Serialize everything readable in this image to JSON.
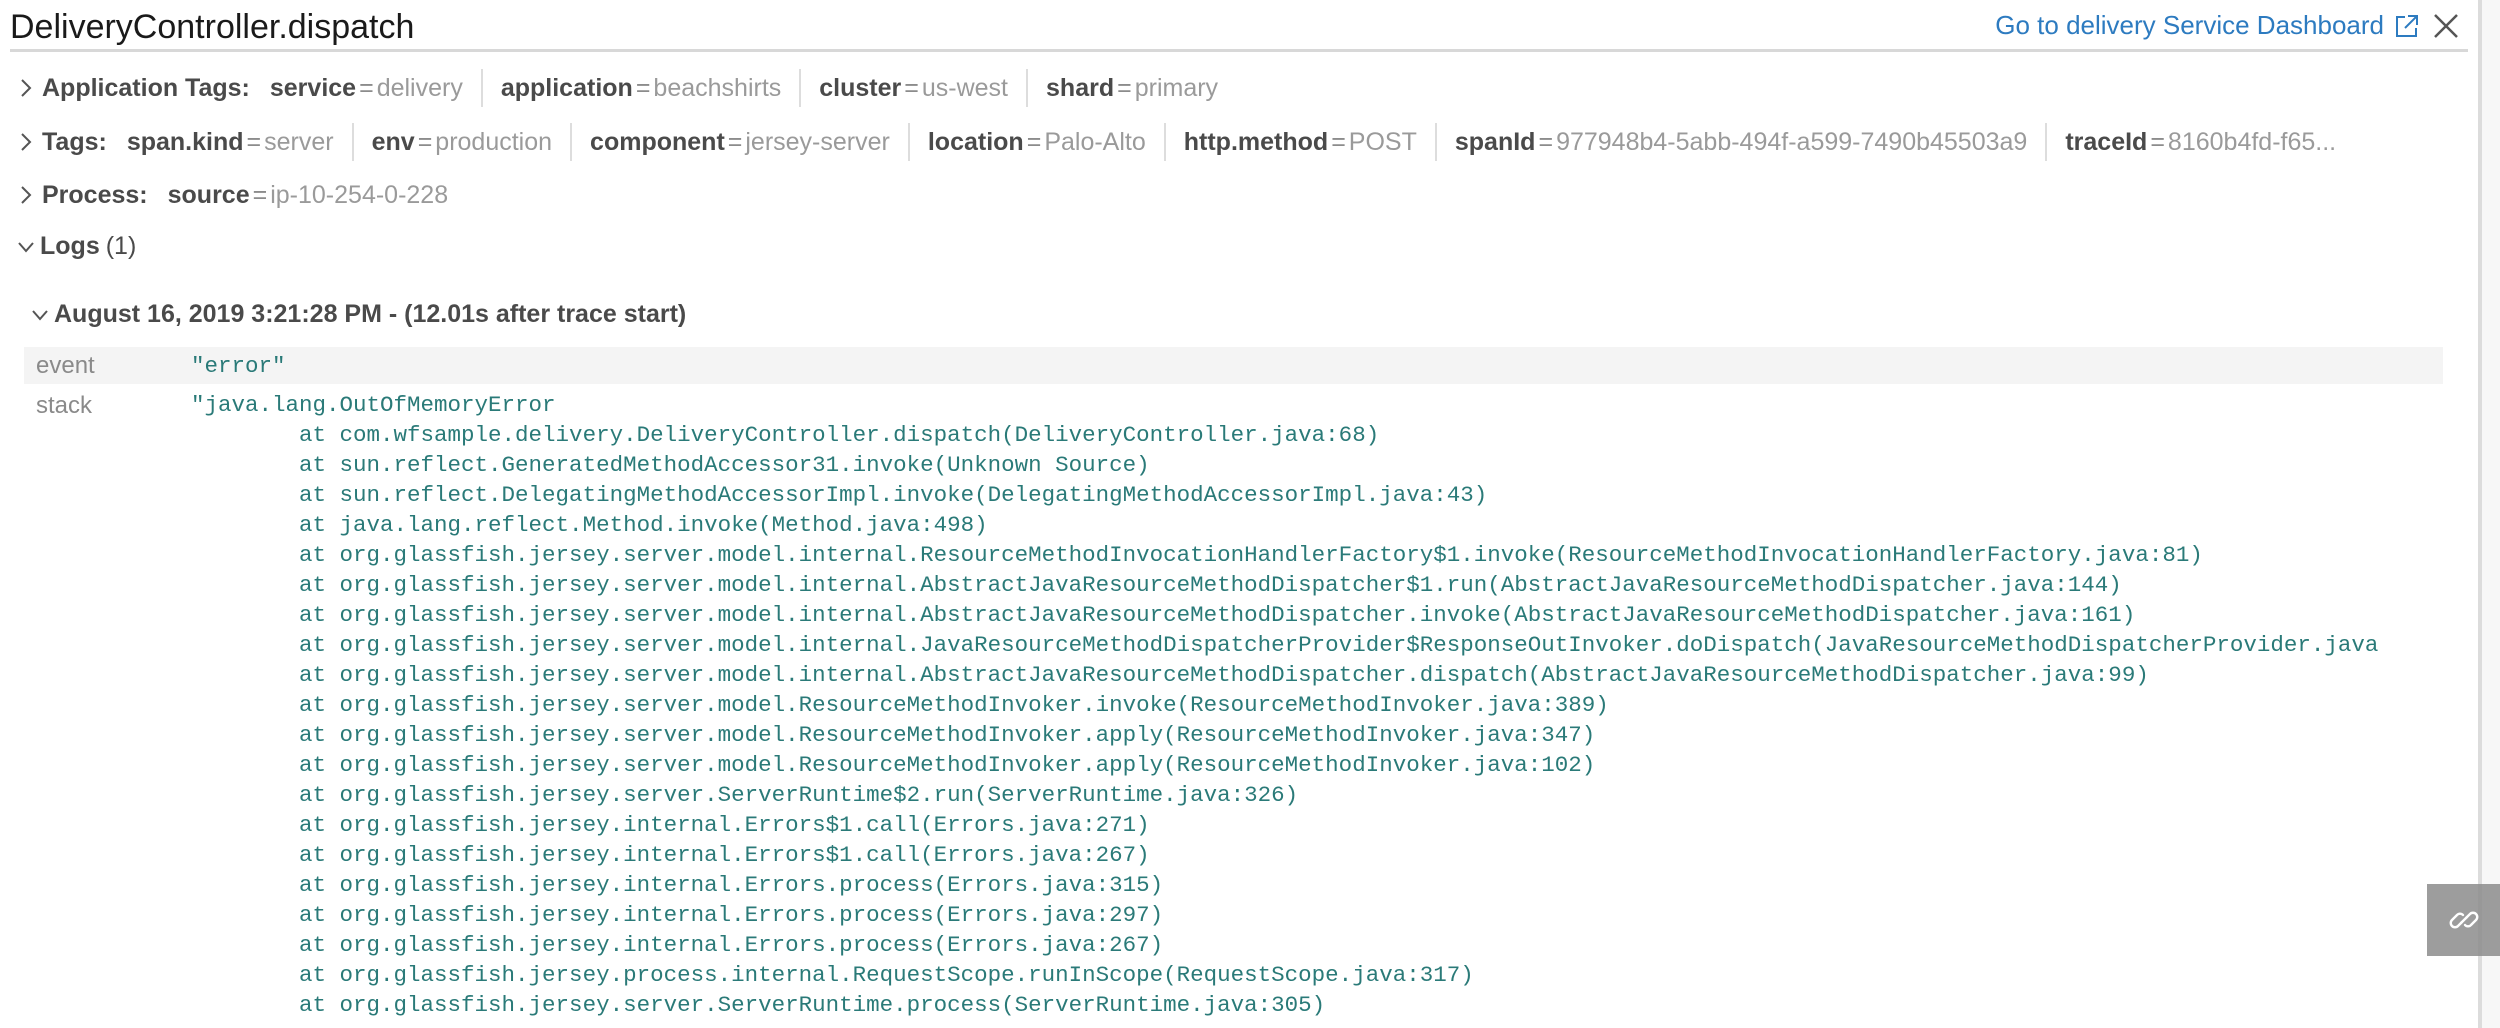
{
  "header": {
    "title": "DeliveryController.dispatch",
    "dashboard_link": "Go to delivery Service Dashboard",
    "dashboard_link_icon": "external-link-icon",
    "close_icon": "close-icon"
  },
  "application_tags": {
    "label": "Application Tags:",
    "expanded": false,
    "items": [
      {
        "key": "service",
        "value": "delivery"
      },
      {
        "key": "application",
        "value": "beachshirts"
      },
      {
        "key": "cluster",
        "value": "us-west"
      },
      {
        "key": "shard",
        "value": "primary"
      }
    ]
  },
  "tags": {
    "label": "Tags:",
    "expanded": false,
    "items": [
      {
        "key": "span.kind",
        "value": "server"
      },
      {
        "key": "env",
        "value": "production"
      },
      {
        "key": "component",
        "value": "jersey-server"
      },
      {
        "key": "location",
        "value": "Palo-Alto"
      },
      {
        "key": "http.method",
        "value": "POST"
      },
      {
        "key": "spanId",
        "value": "977948b4-5abb-494f-a599-7490b45503a9"
      },
      {
        "key": "traceId",
        "value": "8160b4fd-f65..."
      }
    ]
  },
  "process": {
    "label": "Process:",
    "expanded": false,
    "items": [
      {
        "key": "source",
        "value": "ip-10-254-0-228"
      }
    ]
  },
  "logs": {
    "label": "Logs",
    "count": "(1)",
    "expanded": true,
    "entry": {
      "timestamp": "August 16, 2019 3:21:28 PM - (12.01s after trace start)",
      "fields": {
        "event_key": "event",
        "event_value": "\"error\"",
        "stack_key": "stack",
        "stack_lines": [
          "\"java.lang.OutOfMemoryError",
          "        at com.wfsample.delivery.DeliveryController.dispatch(DeliveryController.java:68)",
          "        at sun.reflect.GeneratedMethodAccessor31.invoke(Unknown Source)",
          "        at sun.reflect.DelegatingMethodAccessorImpl.invoke(DelegatingMethodAccessorImpl.java:43)",
          "        at java.lang.reflect.Method.invoke(Method.java:498)",
          "        at org.glassfish.jersey.server.model.internal.ResourceMethodInvocationHandlerFactory$1.invoke(ResourceMethodInvocationHandlerFactory.java:81)",
          "        at org.glassfish.jersey.server.model.internal.AbstractJavaResourceMethodDispatcher$1.run(AbstractJavaResourceMethodDispatcher.java:144)",
          "        at org.glassfish.jersey.server.model.internal.AbstractJavaResourceMethodDispatcher.invoke(AbstractJavaResourceMethodDispatcher.java:161)",
          "        at org.glassfish.jersey.server.model.internal.JavaResourceMethodDispatcherProvider$ResponseOutInvoker.doDispatch(JavaResourceMethodDispatcherProvider.java",
          "        at org.glassfish.jersey.server.model.internal.AbstractJavaResourceMethodDispatcher.dispatch(AbstractJavaResourceMethodDispatcher.java:99)",
          "        at org.glassfish.jersey.server.model.ResourceMethodInvoker.invoke(ResourceMethodInvoker.java:389)",
          "        at org.glassfish.jersey.server.model.ResourceMethodInvoker.apply(ResourceMethodInvoker.java:347)",
          "        at org.glassfish.jersey.server.model.ResourceMethodInvoker.apply(ResourceMethodInvoker.java:102)",
          "        at org.glassfish.jersey.server.ServerRuntime$2.run(ServerRuntime.java:326)",
          "        at org.glassfish.jersey.internal.Errors$1.call(Errors.java:271)",
          "        at org.glassfish.jersey.internal.Errors$1.call(Errors.java:267)",
          "        at org.glassfish.jersey.internal.Errors.process(Errors.java:315)",
          "        at org.glassfish.jersey.internal.Errors.process(Errors.java:297)",
          "        at org.glassfish.jersey.internal.Errors.process(Errors.java:267)",
          "        at org.glassfish.jersey.process.internal.RequestScope.runInScope(RequestScope.java:317)",
          "        at org.glassfish.jersey.server.ServerRuntime.process(ServerRuntime.java:305)"
        ]
      }
    }
  },
  "floating_button": {
    "icon": "link-icon"
  },
  "colors": {
    "link": "#2d7bc0",
    "code": "#2a7a78",
    "row_shade": "#f4f4f4",
    "link_button_bg": "#8c8c8c"
  }
}
